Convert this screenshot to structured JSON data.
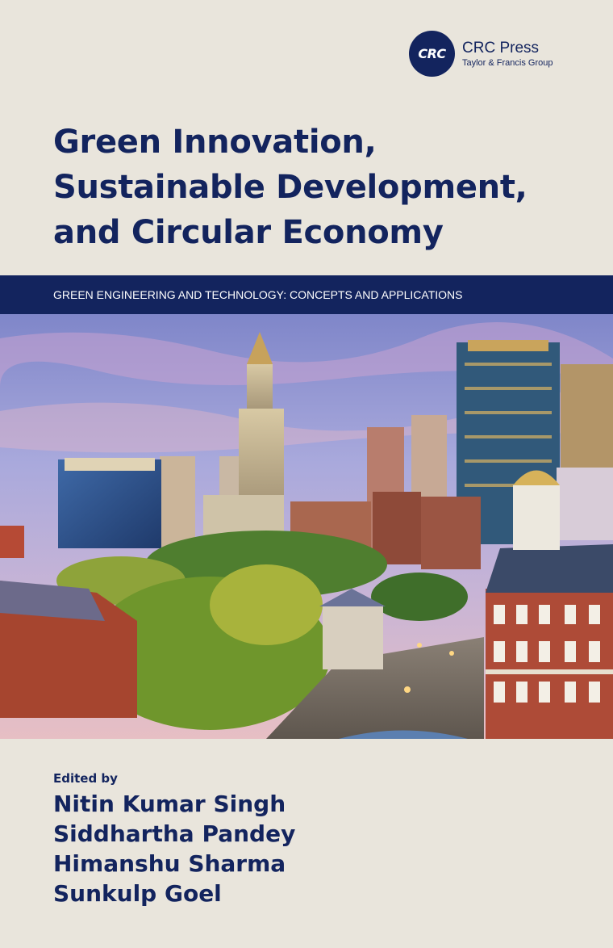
{
  "publisher": {
    "logo_text": "CRC",
    "name": "CRC Press",
    "group": "Taylor & Francis Group"
  },
  "title_lines": [
    "Green Innovation,",
    "Sustainable Development,",
    "and Circular Economy"
  ],
  "series": "GREEN ENGINEERING AND TECHNOLOGY: CONCEPTS AND APPLICATIONS",
  "edited_by_label": "Edited by",
  "editors": [
    "Nitin Kumar Singh",
    "Siddhartha Pandey",
    "Himanshu Sharma",
    "Sunkulp Goel"
  ],
  "colors": {
    "background": "#e9e5dc",
    "brand_navy": "#13245e"
  }
}
